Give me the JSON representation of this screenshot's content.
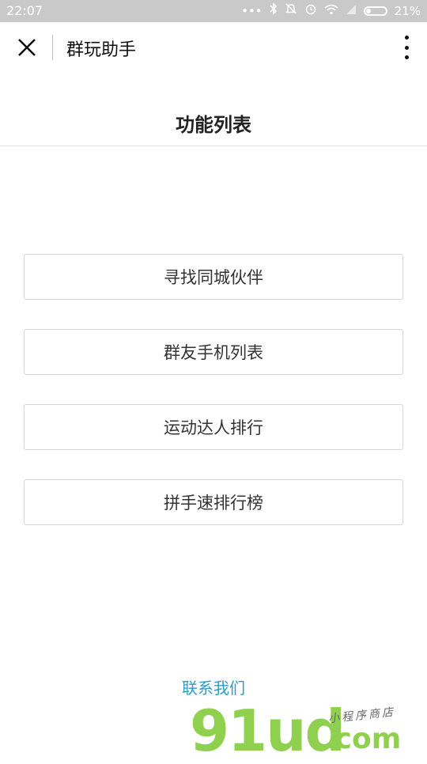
{
  "status_bar": {
    "time": "22:07",
    "battery": "21%",
    "icons": [
      "dots-icon",
      "bluetooth-icon",
      "bell-off-icon",
      "alarm-icon",
      "wifi-icon",
      "signal-icon",
      "battery-icon"
    ]
  },
  "navbar": {
    "title": "群玩助手"
  },
  "page": {
    "section_title": "功能列表",
    "menu_items": [
      {
        "label": "寻找同城伙伴"
      },
      {
        "label": "群友手机列表"
      },
      {
        "label": "运动达人排行"
      },
      {
        "label": "拼手速排行榜"
      }
    ],
    "contact_link": "联系我们"
  },
  "watermark": {
    "logo": "91ud",
    "suffix": ".com",
    "tagline": "小程序商店"
  },
  "colors": {
    "status_bar_bg": "#c9c9c9",
    "link": "#2e9bc6",
    "watermark": "#8fd14f"
  }
}
